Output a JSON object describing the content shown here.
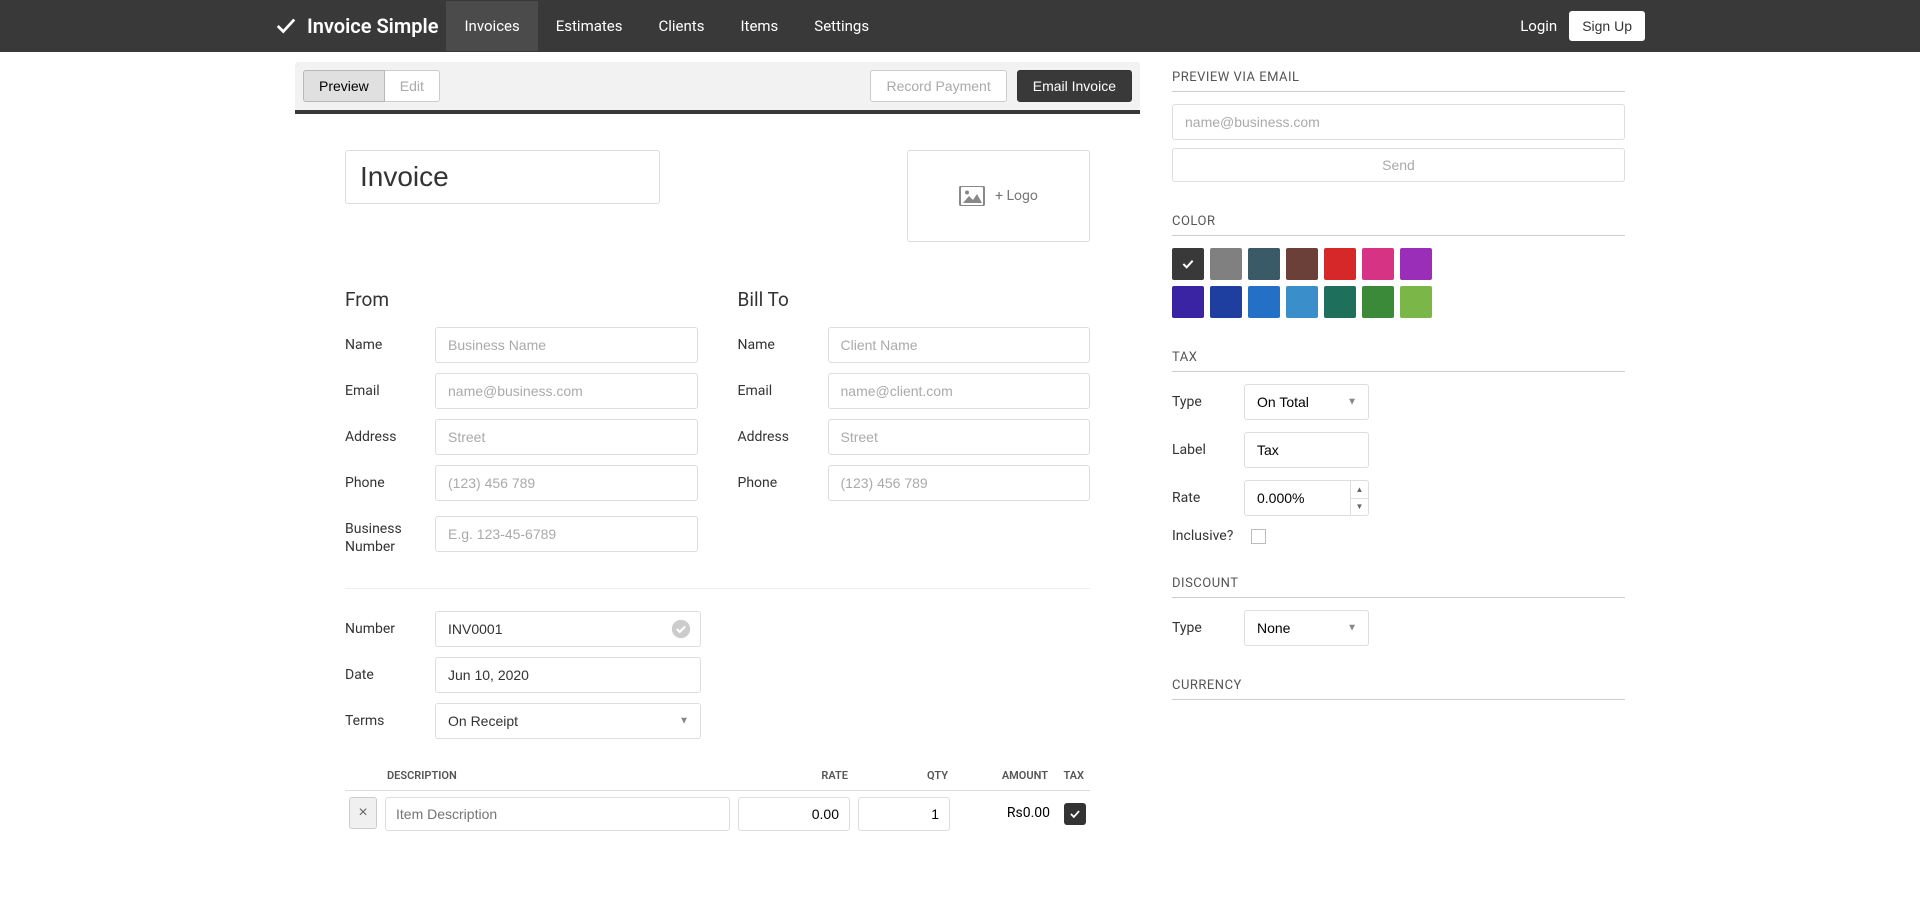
{
  "brand": "Invoice Simple",
  "nav": {
    "items": [
      "Invoices",
      "Estimates",
      "Clients",
      "Items",
      "Settings"
    ],
    "login": "Login",
    "signup": "Sign Up"
  },
  "actionBar": {
    "preview": "Preview",
    "edit": "Edit",
    "recordPayment": "Record Payment",
    "emailInvoice": "Email Invoice"
  },
  "doc": {
    "title": "Invoice",
    "logoLabel": "+ Logo",
    "from": {
      "heading": "From",
      "name": {
        "label": "Name",
        "placeholder": "Business Name"
      },
      "email": {
        "label": "Email",
        "placeholder": "name@business.com"
      },
      "address": {
        "label": "Address",
        "placeholder": "Street"
      },
      "phone": {
        "label": "Phone",
        "placeholder": "(123) 456 789"
      },
      "businessNumber": {
        "label": "Business Number",
        "placeholder": "E.g. 123-45-6789"
      }
    },
    "billTo": {
      "heading": "Bill To",
      "name": {
        "label": "Name",
        "placeholder": "Client Name"
      },
      "email": {
        "label": "Email",
        "placeholder": "name@client.com"
      },
      "address": {
        "label": "Address",
        "placeholder": "Street"
      },
      "phone": {
        "label": "Phone",
        "placeholder": "(123) 456 789"
      }
    },
    "meta": {
      "number": {
        "label": "Number",
        "value": "INV0001"
      },
      "date": {
        "label": "Date",
        "value": "Jun 10, 2020"
      },
      "terms": {
        "label": "Terms",
        "value": "On Receipt"
      }
    },
    "items": {
      "headers": {
        "description": "DESCRIPTION",
        "rate": "RATE",
        "qty": "QTY",
        "amount": "AMOUNT",
        "tax": "TAX"
      },
      "row": {
        "descriptionPlaceholder": "Item Description",
        "rate": "0.00",
        "qty": "1",
        "amount": "Rs0.00"
      }
    }
  },
  "sidebar": {
    "previewEmail": {
      "heading": "PREVIEW VIA EMAIL",
      "placeholder": "name@business.com",
      "send": "Send"
    },
    "color": {
      "heading": "COLOR",
      "swatches": [
        "#393939",
        "#808080",
        "#3a5a68",
        "#6b4039",
        "#d62828",
        "#d63384",
        "#9b2eb8",
        "#3a24a3",
        "#1e3fa0",
        "#2570c7",
        "#3a8ec9",
        "#1e6f5c",
        "#3a8a3a",
        "#7ab648"
      ]
    },
    "tax": {
      "heading": "TAX",
      "type": {
        "label": "Type",
        "value": "On Total"
      },
      "labelField": {
        "label": "Label",
        "value": "Tax"
      },
      "rate": {
        "label": "Rate",
        "value": "0.000%"
      },
      "inclusive": {
        "label": "Inclusive?"
      }
    },
    "discount": {
      "heading": "DISCOUNT",
      "type": {
        "label": "Type",
        "value": "None"
      }
    },
    "currency": {
      "heading": "CURRENCY"
    }
  }
}
